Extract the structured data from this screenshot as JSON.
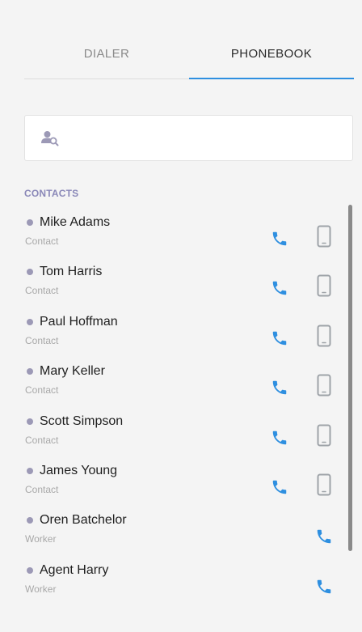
{
  "tabs": {
    "dialer": "DIALER",
    "phonebook": "PHONEBOOK"
  },
  "search": {
    "placeholder": "",
    "value": ""
  },
  "section": {
    "title": "CONTACTS"
  },
  "colors": {
    "accent": "#2e8fe0",
    "dot": "#9c99b6",
    "mobile_icon": "#9ea3a8"
  },
  "contacts": [
    {
      "name": "Mike Adams",
      "type": "Contact",
      "icons": [
        "phone-icon",
        "mobile-icon"
      ]
    },
    {
      "name": "Tom Harris",
      "type": "Contact",
      "icons": [
        "phone-icon",
        "mobile-icon"
      ]
    },
    {
      "name": "Paul Hoffman",
      "type": "Contact",
      "icons": [
        "phone-icon",
        "mobile-icon"
      ]
    },
    {
      "name": "Mary Keller",
      "type": "Contact",
      "icons": [
        "phone-icon",
        "mobile-icon"
      ]
    },
    {
      "name": "Scott Simpson",
      "type": "Contact",
      "icons": [
        "phone-icon",
        "mobile-icon"
      ]
    },
    {
      "name": "James Young",
      "type": "Contact",
      "icons": [
        "phone-icon",
        "mobile-icon"
      ]
    },
    {
      "name": "Oren Batchelor",
      "type": "Worker",
      "icons": [
        "phone-icon"
      ]
    },
    {
      "name": "Agent Harry",
      "type": "Worker",
      "icons": [
        "phone-icon"
      ]
    }
  ]
}
